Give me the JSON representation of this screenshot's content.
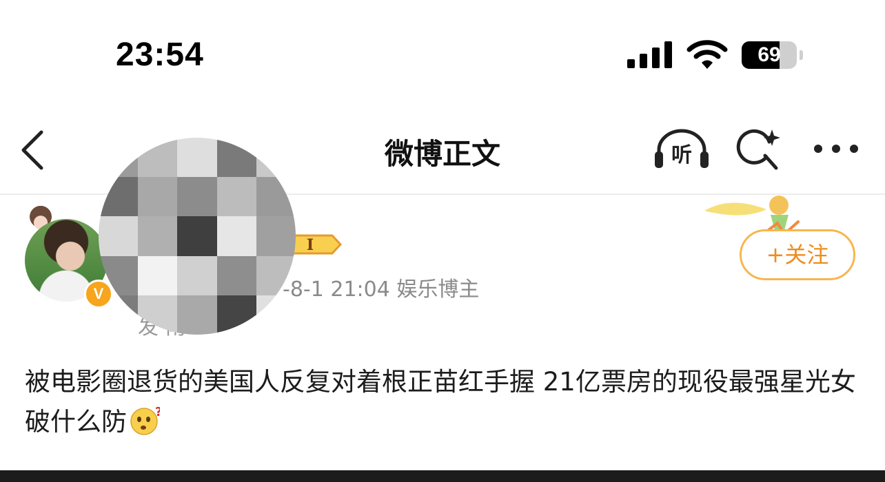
{
  "status_bar": {
    "time": "23:54",
    "battery_level": "69",
    "battery_fraction": 0.69
  },
  "nav": {
    "title": "微博正文",
    "listen_label": "听"
  },
  "post": {
    "meta_time_category": "-8-1 21:04  娱乐博主",
    "meta_source": "发   南",
    "level_badge": "I",
    "vip_badge": "V",
    "follow_label": "+关注",
    "text": "被电影圈退货的美国人反复对着根正苗红手握 21亿票房的现役最强星光女破什么防"
  },
  "colors": {
    "accent": "#ee8b1e",
    "follow_border": "#f7b64f",
    "vip": "#f7a51c"
  }
}
